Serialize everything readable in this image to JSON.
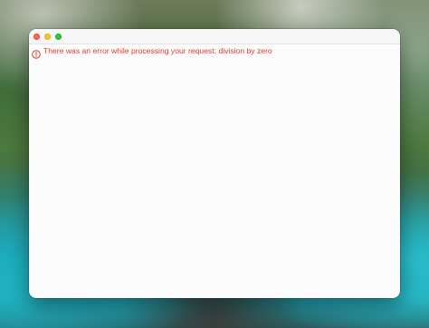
{
  "window": {
    "error": {
      "icon": "exclamation-circle-icon",
      "message": "There was an error while processing your request: division by zero",
      "color": "#e0392b"
    },
    "traffic_lights": {
      "close_color": "#fe5f57",
      "minimize_color": "#febc2e",
      "maximize_color": "#28c840"
    }
  }
}
